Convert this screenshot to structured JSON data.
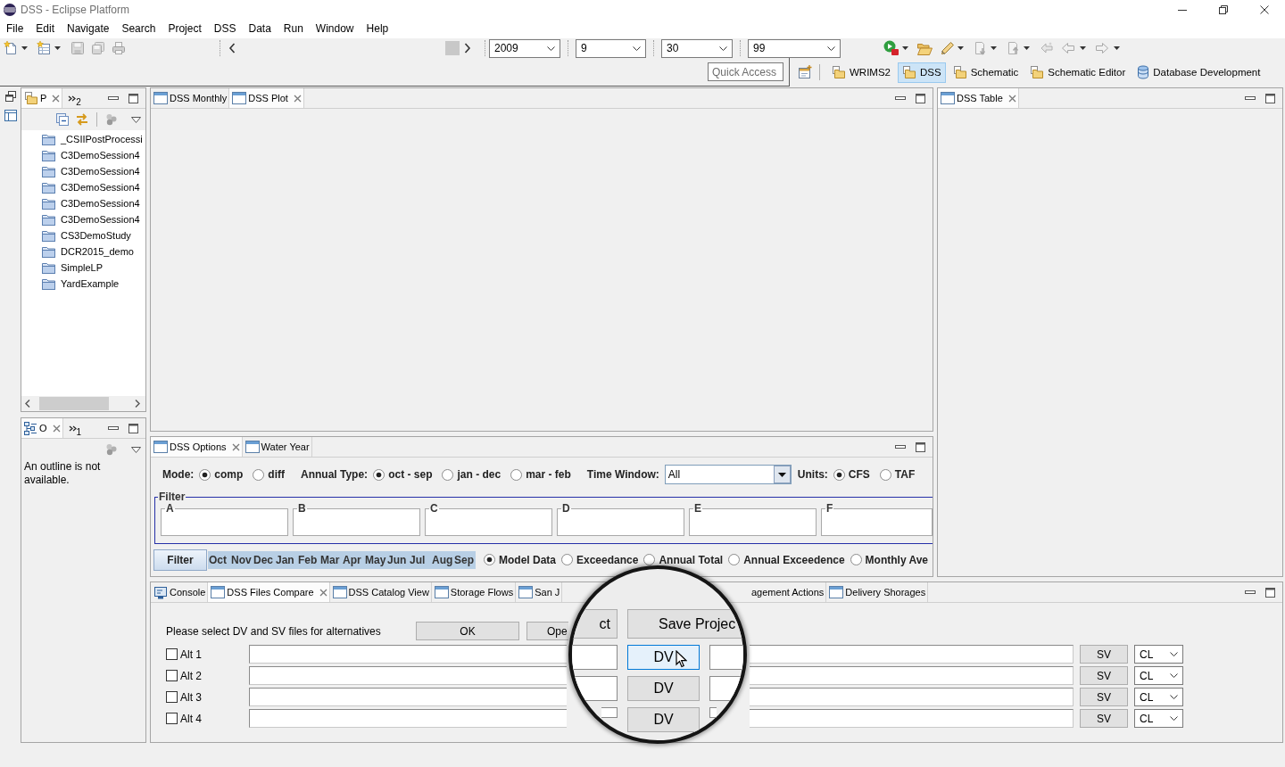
{
  "window": {
    "title": "DSS - Eclipse Platform"
  },
  "menu_bar": [
    "File",
    "Edit",
    "Navigate",
    "Search",
    "Project",
    "DSS",
    "Data",
    "Run",
    "Window",
    "Help"
  ],
  "toolbar": {
    "date_combos": [
      {
        "value": "2009"
      },
      {
        "value": "9"
      },
      {
        "value": "30"
      },
      {
        "value": "99"
      }
    ],
    "quick_access": {
      "placeholder": "Quick Access"
    },
    "perspectives": [
      {
        "label": "WRIMS2",
        "kind": "folder",
        "selected": false
      },
      {
        "label": "DSS",
        "kind": "folder",
        "selected": true
      },
      {
        "label": "Schematic",
        "kind": "folder",
        "selected": false
      },
      {
        "label": "Schematic Editor",
        "kind": "folder",
        "selected": false
      },
      {
        "label": "Database Development",
        "kind": "database",
        "selected": false
      }
    ]
  },
  "project_view": {
    "tabs": [
      {
        "label": "P",
        "kind": "project",
        "selected": true
      }
    ],
    "hidden_tabs": "2",
    "items": [
      "_CSIIPostProcessi",
      "C3DemoSession4",
      "C3DemoSession4",
      "C3DemoSession4",
      "C3DemoSession4",
      "C3DemoSession4",
      "CS3DemoStudy",
      "DCR2015_demo",
      "SimpleLP",
      "YardExample"
    ]
  },
  "outline_view": {
    "tabs": [
      {
        "label": "O",
        "kind": "outline",
        "selected": true
      }
    ],
    "hidden_tabs": "1",
    "message": "An outline is not available."
  },
  "editor": {
    "tabs": [
      {
        "label": "DSS Monthly",
        "kind": "view",
        "selected": false
      },
      {
        "label": "DSS Plot",
        "kind": "view",
        "selected": true
      }
    ]
  },
  "table_view": {
    "tabs": [
      {
        "label": "DSS Table",
        "kind": "view",
        "selected": true
      }
    ]
  },
  "options_view": {
    "tabs": [
      {
        "label": "DSS Options",
        "kind": "view",
        "selected": true
      },
      {
        "label": "Water Year",
        "kind": "view",
        "selected": false
      }
    ],
    "controls": [
      {
        "label": "Mode:",
        "kind": "radio",
        "options": [
          {
            "label": "comp",
            "selected": true
          },
          {
            "label": "diff",
            "selected": false
          }
        ]
      },
      {
        "label": "Annual Type:",
        "kind": "radio",
        "options": [
          {
            "label": "oct - sep",
            "selected": true
          },
          {
            "label": "jan - dec",
            "selected": false
          },
          {
            "label": "mar - feb",
            "selected": false
          }
        ]
      },
      {
        "label": "Time Window:",
        "kind": "combo",
        "value": "All"
      },
      {
        "label": "Units:",
        "kind": "radio",
        "options": [
          {
            "label": "CFS",
            "selected": true
          },
          {
            "label": "TAF",
            "selected": false
          }
        ]
      }
    ],
    "filter": {
      "title": "Filter",
      "fields": [
        "A",
        "B",
        "C",
        "D",
        "E",
        "F"
      ]
    },
    "filter_button": "Filter",
    "months": [
      {
        "label": "Oct",
        "selected": true
      },
      {
        "label": "Nov",
        "selected": true
      },
      {
        "label": "Dec",
        "selected": true
      },
      {
        "label": "Jan",
        "selected": true
      },
      {
        "label": "Feb",
        "selected": true
      },
      {
        "label": "Mar",
        "selected": true
      },
      {
        "label": "Apr",
        "selected": true
      },
      {
        "label": "May",
        "selected": true
      },
      {
        "label": "Jun",
        "selected": true
      },
      {
        "label": "Jul",
        "selected": true
      },
      {
        "label": "Aug",
        "selected": true
      },
      {
        "label": "Sep",
        "selected": true
      }
    ],
    "display": [
      {
        "label": "Model Data",
        "selected": true
      },
      {
        "label": "Exceedance",
        "selected": false
      },
      {
        "label": "Annual Total",
        "selected": false
      },
      {
        "label": "Annual Exceedence",
        "selected": false
      },
      {
        "label": "Monthly Ave",
        "selected": false
      }
    ]
  },
  "files_compare": {
    "tabs": [
      {
        "label": "Console",
        "kind": "console",
        "selected": false
      },
      {
        "label": "DSS Files Compare",
        "kind": "view",
        "selected": true
      },
      {
        "label": "DSS Catalog View",
        "kind": "view",
        "selected": false
      },
      {
        "label": "Storage Flows",
        "kind": "view",
        "selected": false
      },
      {
        "label": "San J",
        "kind": "view",
        "selected": false
      },
      {
        "label": "agement Actions",
        "kind": "plain",
        "selected": false
      },
      {
        "label": "Delivery Shorages",
        "kind": "view",
        "selected": false
      }
    ],
    "prompt": "Please select DV and SV files for alternatives",
    "buttons": [
      "OK",
      "Ope"
    ],
    "alternatives": [
      {
        "label": "Alt 1",
        "checked": false,
        "sv_button": "SV",
        "type": "CL"
      },
      {
        "label": "Alt 2",
        "checked": false,
        "sv_button": "SV",
        "type": "CL"
      },
      {
        "label": "Alt 3",
        "checked": false,
        "sv_button": "SV",
        "type": "CL"
      },
      {
        "label": "Alt 4",
        "checked": false,
        "sv_button": "SV",
        "type": "CL"
      }
    ]
  },
  "magnifier": {
    "buttons": [
      "ct",
      "Save Projec"
    ],
    "dv_buttons": [
      {
        "label": "DV",
        "hovered": true
      },
      {
        "label": "DV",
        "hovered": false
      },
      {
        "label": "DV",
        "hovered": false
      }
    ]
  }
}
